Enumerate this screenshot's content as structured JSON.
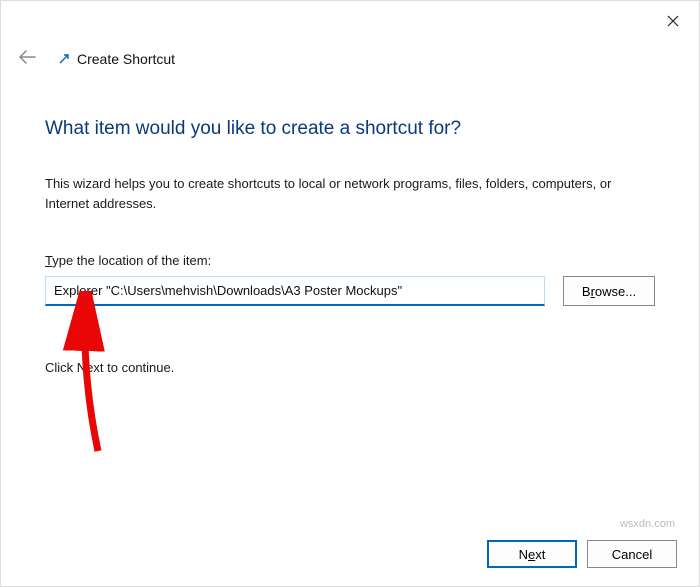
{
  "window": {
    "title": "Create Shortcut"
  },
  "content": {
    "heading": "What item would you like to create a shortcut for?",
    "description": "This wizard helps you to create shortcuts to local or network programs, files, folders, computers, or Internet addresses.",
    "field_label_pre": "T",
    "field_label_rest": "ype the location of the item:",
    "input_value": "Explorer \"C:\\Users\\mehvish\\Downloads\\A3 Poster Mockups\"",
    "browse_label_pre": "B",
    "browse_label_mid": "r",
    "browse_label_post": "owse...",
    "continue_pre": "Click N",
    "continue_mid": "e",
    "continue_post": "xt to continue."
  },
  "footer": {
    "next_pre": "N",
    "next_mid": "e",
    "next_post": "xt",
    "cancel": "Cancel"
  },
  "watermark": "wsxdn.com"
}
